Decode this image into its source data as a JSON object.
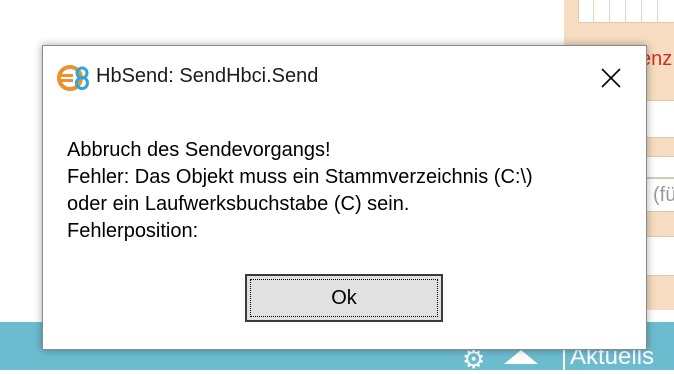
{
  "background": {
    "partial_label": "enz",
    "partial_input": "(fü",
    "bottom_bar_label": "Aktuells",
    "icons": [
      "gear-icon",
      "up-arrow-icon"
    ],
    "colors": {
      "bottom_bar": "#6cbcd0",
      "side_panel": "#f6dcc0",
      "accent_red": "#d0301c"
    }
  },
  "dialog": {
    "title": "HbSend: SendHbci.Send",
    "app_icon": "euro-8-logo-icon",
    "close_icon": "close-icon",
    "message_lines": [
      "Abbruch des Sendevorgangs!",
      "Fehler: Das Objekt muss ein Stammverzeichnis (C:\\)",
      "oder ein Laufwerksbuchstabe (C) sein.",
      "Fehlerposition:"
    ],
    "ok_label": "Ok"
  }
}
